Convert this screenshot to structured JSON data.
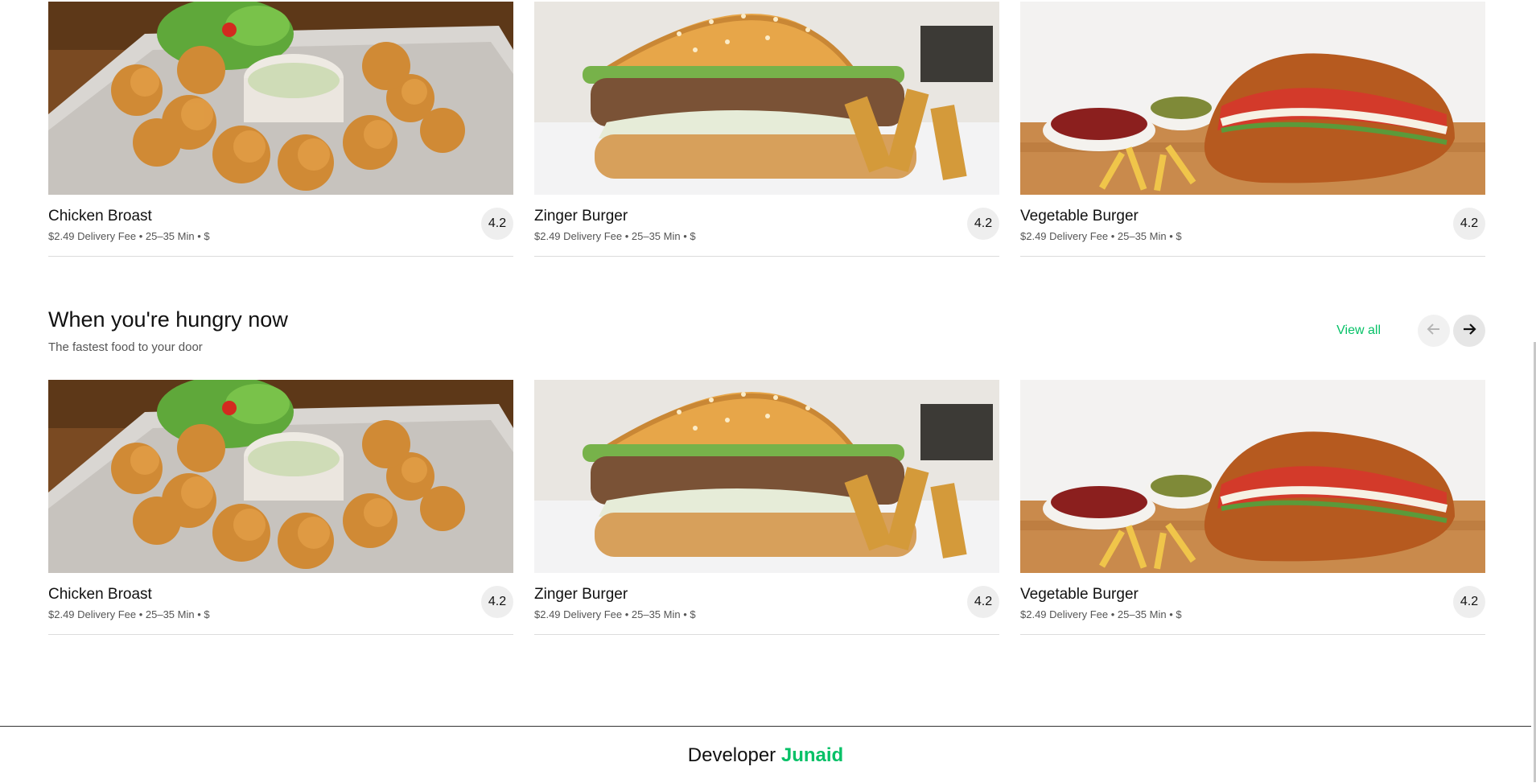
{
  "cards": [
    {
      "title": "Chicken Broast",
      "meta": "$2.49 Delivery Fee • 25–35 Min • $",
      "rating": "4.2",
      "image": "chicken-broast"
    },
    {
      "title": "Zinger Burger",
      "meta": "$2.49 Delivery Fee • 25–35 Min • $",
      "rating": "4.2",
      "image": "zinger-burger"
    },
    {
      "title": "Vegetable Burger",
      "meta": "$2.49 Delivery Fee • 25–35 Min • $",
      "rating": "4.2",
      "image": "vegetable-burger"
    }
  ],
  "section": {
    "title": "When you're hungry now",
    "subtitle": "The fastest food to your door",
    "view_all": "View all",
    "prev_icon": "arrow-left-icon",
    "next_icon": "arrow-right-icon"
  },
  "footer": {
    "label": "Developer",
    "name": "Junaid"
  },
  "colors": {
    "accent": "#06c167",
    "text": "#111111",
    "muted": "#555555"
  }
}
